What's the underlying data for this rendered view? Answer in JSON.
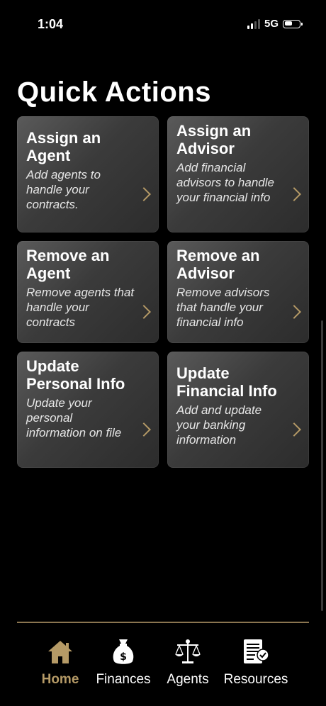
{
  "status_bar": {
    "time": "1:04",
    "network": "5G"
  },
  "page": {
    "title": "Quick Actions"
  },
  "cards": [
    {
      "title": "Assign an Agent",
      "description": "Add agents to handle your contracts."
    },
    {
      "title": "Assign an Advisor",
      "description": "Add financial advisors to handle your financial info"
    },
    {
      "title": "Remove an Agent",
      "description": "Remove agents that handle your contracts"
    },
    {
      "title": "Remove an Advisor",
      "description": "Remove  advisors that handle your financial info"
    },
    {
      "title": "Update Personal Info",
      "description": "Update your personal information on file"
    },
    {
      "title": "Update Financial Info",
      "description": "Add and update your banking information"
    }
  ],
  "tabs": [
    {
      "label": "Home",
      "icon": "home-icon",
      "active": true
    },
    {
      "label": "Finances",
      "icon": "money-bag-icon",
      "active": false
    },
    {
      "label": "Agents",
      "icon": "scales-icon",
      "active": false
    },
    {
      "label": "Resources",
      "icon": "document-icon",
      "active": false
    }
  ],
  "colors": {
    "accent": "#b59a66",
    "background": "#000000",
    "card": "#3b3b3b"
  }
}
